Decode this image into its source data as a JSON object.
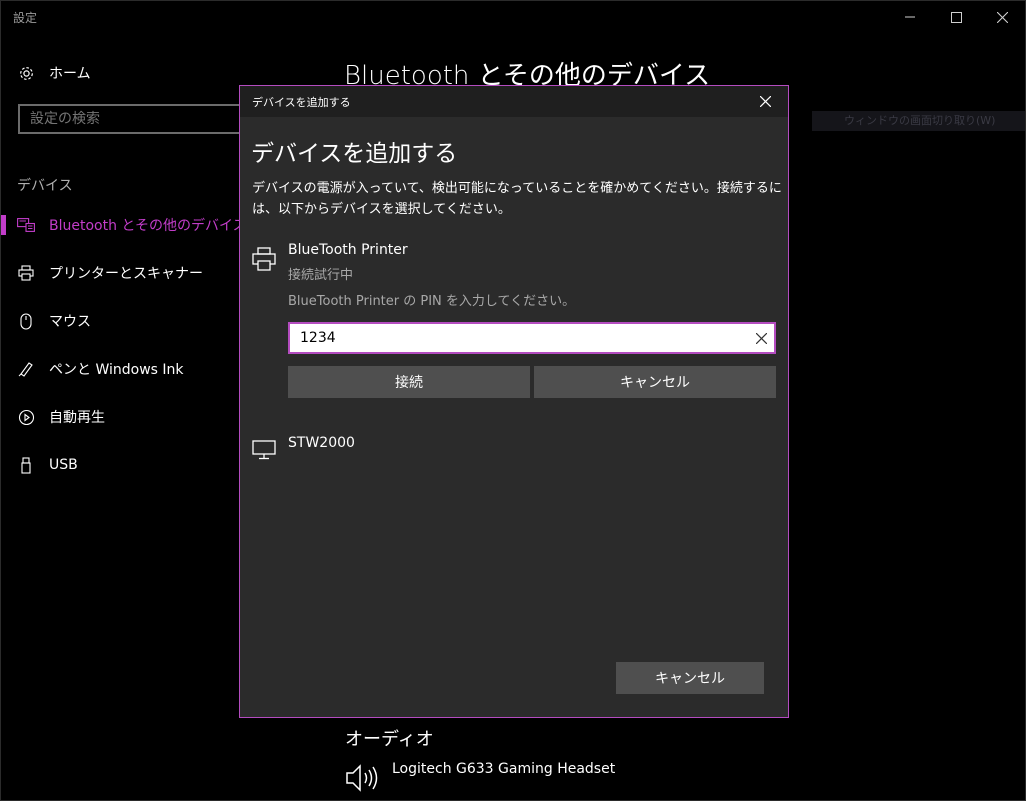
{
  "window": {
    "title": "設定"
  },
  "sidebar": {
    "home_label": "ホーム",
    "search_placeholder": "設定の検索",
    "section_label": "デバイス",
    "items": [
      {
        "label": "Bluetooth とその他のデバイス",
        "icon": "keyboard-icon",
        "selected": true
      },
      {
        "label": "プリンターとスキャナー",
        "icon": "printer-icon"
      },
      {
        "label": "マウス",
        "icon": "mouse-icon"
      },
      {
        "label": "ペンと Windows Ink",
        "icon": "pen-icon"
      },
      {
        "label": "自動再生",
        "icon": "autoplay-icon"
      },
      {
        "label": "USB",
        "icon": "usb-icon"
      }
    ]
  },
  "main": {
    "page_title": "Bluetooth とその他のデバイス",
    "hint_text": "ウィンドウの画面切り取り(W)",
    "audio_section_title": "オーディオ",
    "audio_device": "Logitech G633 Gaming Headset"
  },
  "dialog": {
    "title": "デバイスを追加する",
    "heading": "デバイスを追加する",
    "description": "デバイスの電源が入っていて、検出可能になっていることを確かめてください。接続するには、以下からデバイスを選択してください。",
    "devices": [
      {
        "name": "BlueTooth Printer",
        "status": "接続試行中",
        "icon": "printer-icon"
      },
      {
        "name": "STW2000",
        "icon": "monitor-icon"
      }
    ],
    "pin_prompt": "BlueTooth Printer の PIN を入力してください。",
    "pin_value": "1234",
    "connect_label": "接続",
    "cancel_inline_label": "キャンセル",
    "cancel_label": "キャンセル"
  },
  "colors": {
    "accent": "#c23dc9",
    "dialog_border": "#b44cc0",
    "dialog_bg": "#2b2b2b",
    "button_bg": "#4f4f4f"
  }
}
